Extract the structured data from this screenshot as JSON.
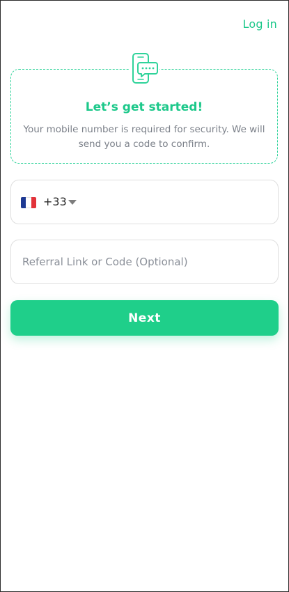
{
  "header": {
    "login_label": "Log in"
  },
  "info_card": {
    "icon": "phone-message-icon",
    "title": "Let’s get started!",
    "description": "Your mobile number is required for security. We will send you a code to confirm."
  },
  "phone": {
    "country_flag": "france-flag-icon",
    "dial_code": "+33",
    "dropdown_icon": "caret-down-icon"
  },
  "referral": {
    "placeholder": "Referral Link or Code (Optional)",
    "value": ""
  },
  "actions": {
    "next_label": "Next"
  },
  "colors": {
    "accent": "#1fcf8a",
    "text_muted": "#7b8089",
    "field_border": "#dedede"
  }
}
